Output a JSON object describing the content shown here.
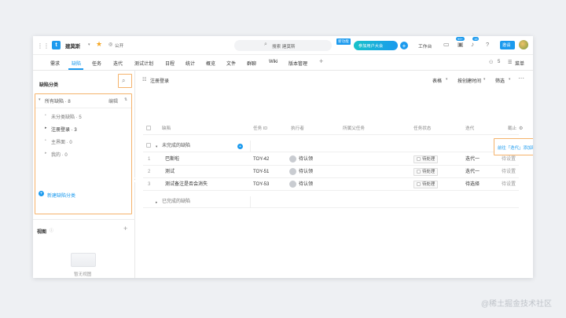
{
  "app": {
    "name": "建莫斯",
    "visibility": "公开"
  },
  "search": {
    "placeholder": "搜索 建莫斯"
  },
  "promo": {
    "badge": "新功能",
    "label": "参加用户大会"
  },
  "topbar_right": {
    "workbench": "工作台",
    "badge_a": "99+",
    "badge_b": "15",
    "upgrade": "邀请"
  },
  "tabs": [
    "需求",
    "缺陷",
    "任务",
    "迭代",
    "测试计划",
    "日程",
    "统计",
    "概览",
    "文件",
    "群聊",
    "Wiki",
    "版本管理"
  ],
  "tabs_active_index": 1,
  "tabs_right": {
    "count": "5",
    "menu": "菜单"
  },
  "sidebar": {
    "title": "缺陷分类",
    "all_label": "所有缺陷 · 8",
    "all_action": "编辑",
    "items": [
      "未分类缺陷 · 5",
      "注册登录 · 3",
      "主界面 · 0",
      "我的 · 0"
    ],
    "new_label": "新建缺陷分类",
    "view_title": "视图",
    "empty_view": "暂无视图"
  },
  "main": {
    "breadcrumb": "注册登录",
    "toolbar": {
      "view": "表格",
      "group": "按创建时间",
      "filter": "筛选"
    },
    "columns": [
      "缺陷",
      "任务 ID",
      "执行者",
      "所属父任务",
      "任务状态",
      "迭代",
      "截止"
    ],
    "group_incomplete": "未完成的缺陷",
    "add_link": "前往「迭代」添加缺陷",
    "rows": [
      {
        "num": "1",
        "title": "巴斯啦",
        "id": "TOY-42",
        "assignee": "待认领",
        "status": "待处理",
        "sprint": "迭代一",
        "due": "待设置"
      },
      {
        "num": "2",
        "title": "测试",
        "id": "TOY-51",
        "assignee": "待认领",
        "status": "待处理",
        "sprint": "迭代一",
        "due": "待设置"
      },
      {
        "num": "3",
        "title": "测试备注是否会消失",
        "id": "TOY-53",
        "assignee": "待认领",
        "status": "待处理",
        "sprint": "待选择",
        "due": "待设置"
      }
    ],
    "group_complete": "已完成的缺陷"
  },
  "watermark": "@稀土掘金技术社区",
  "colors": {
    "accent": "#1b9aee",
    "orange": "#f5a040",
    "active_tab": "#1b9aee"
  }
}
